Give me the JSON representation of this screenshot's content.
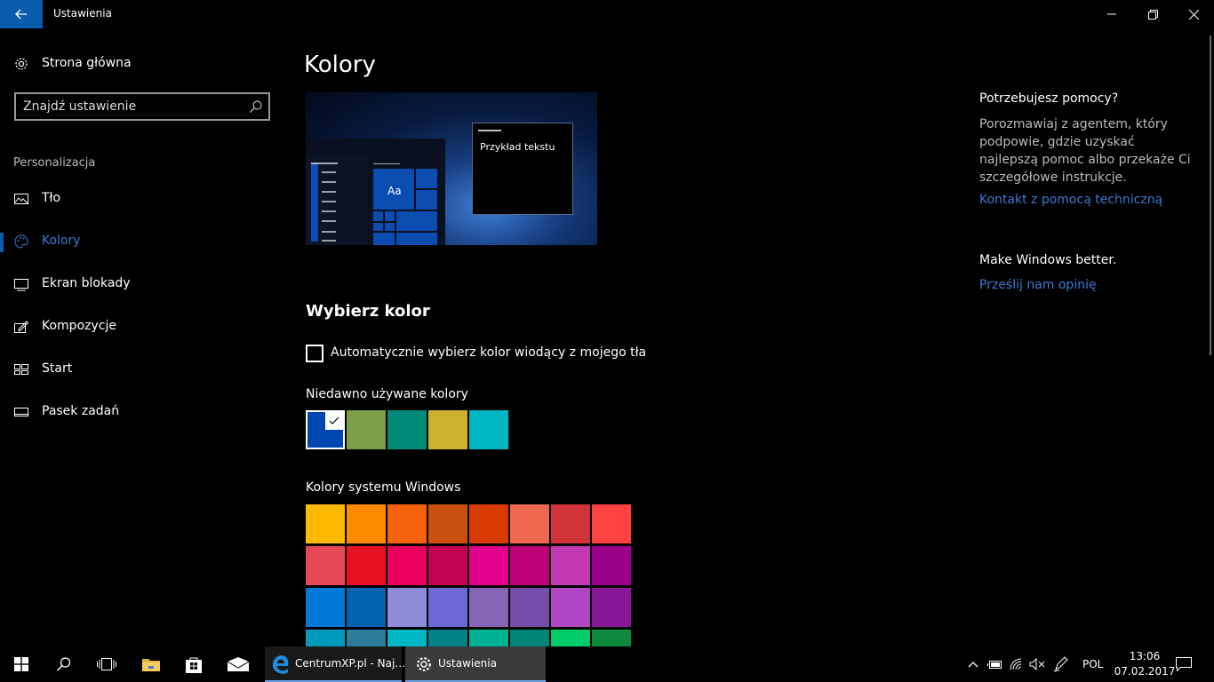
{
  "window": {
    "title": "Ustawienia"
  },
  "nav": {
    "home_label": "Strona główna",
    "search_placeholder": "Znajdź ustawienie",
    "section": "Personalizacja",
    "items": [
      {
        "label": "Tło",
        "icon": "picture-icon"
      },
      {
        "label": "Kolory",
        "icon": "palette-icon",
        "active": true
      },
      {
        "label": "Ekran blokady",
        "icon": "lock-screen-icon"
      },
      {
        "label": "Kompozycje",
        "icon": "themes-icon"
      },
      {
        "label": "Start",
        "icon": "start-icon"
      },
      {
        "label": "Pasek zadań",
        "icon": "taskbar-icon"
      }
    ]
  },
  "main": {
    "title": "Kolory",
    "preview_sample_text": "Przykład tekstu",
    "preview_tile_text": "Aa",
    "choose_heading": "Wybierz kolor",
    "auto_checkbox_label": "Automatycznie wybierz kolor wiodący z mojego tła",
    "auto_checked": false,
    "recent_heading": "Niedawno używane kolory",
    "recent_colors": [
      "#0046b0",
      "#7a9e48",
      "#028b76",
      "#cdb12e",
      "#00b7c3"
    ],
    "selected_recent_index": 0,
    "system_heading": "Kolory systemu Windows",
    "system_colors": [
      [
        "#ffb900",
        "#ff8c00",
        "#f7630c",
        "#ca5010",
        "#da3b01",
        "#ef6950",
        "#d13438",
        "#ff4343"
      ],
      [
        "#e74856",
        "#e81123",
        "#ea005e",
        "#c30052",
        "#e3008c",
        "#bf0077",
        "#c239b3",
        "#9a0089"
      ],
      [
        "#0078d7",
        "#0063b1",
        "#8e8cd8",
        "#6b69d6",
        "#8764b8",
        "#744da9",
        "#b146c2",
        "#881798"
      ],
      [
        "#0099bc",
        "#2d7d9a",
        "#00b7c3",
        "#038387",
        "#00b294",
        "#018574",
        "#00cc6a",
        "#10893e"
      ]
    ]
  },
  "help": {
    "title": "Potrzebujesz pomocy?",
    "body": "Porozmawiaj z agentem, który podpowie, gdzie uzyskać najlepszą pomoc albo przekaże Ci szczegółowe instrukcje.",
    "link": "Kontakt z pomocą techniczną",
    "better_title": "Make Windows better.",
    "feedback_link": "Prześlij nam opinię"
  },
  "taskbar": {
    "apps": [
      {
        "label": "CentrumXP.pl - Naj…",
        "icon": "edge-icon"
      },
      {
        "label": "Ustawienia",
        "icon": "gear-icon"
      }
    ],
    "language": "POL",
    "time": "13:06",
    "date": "07.02.2017"
  },
  "colors": {
    "accent": "#0b5cad",
    "link": "#3a7bd5"
  }
}
